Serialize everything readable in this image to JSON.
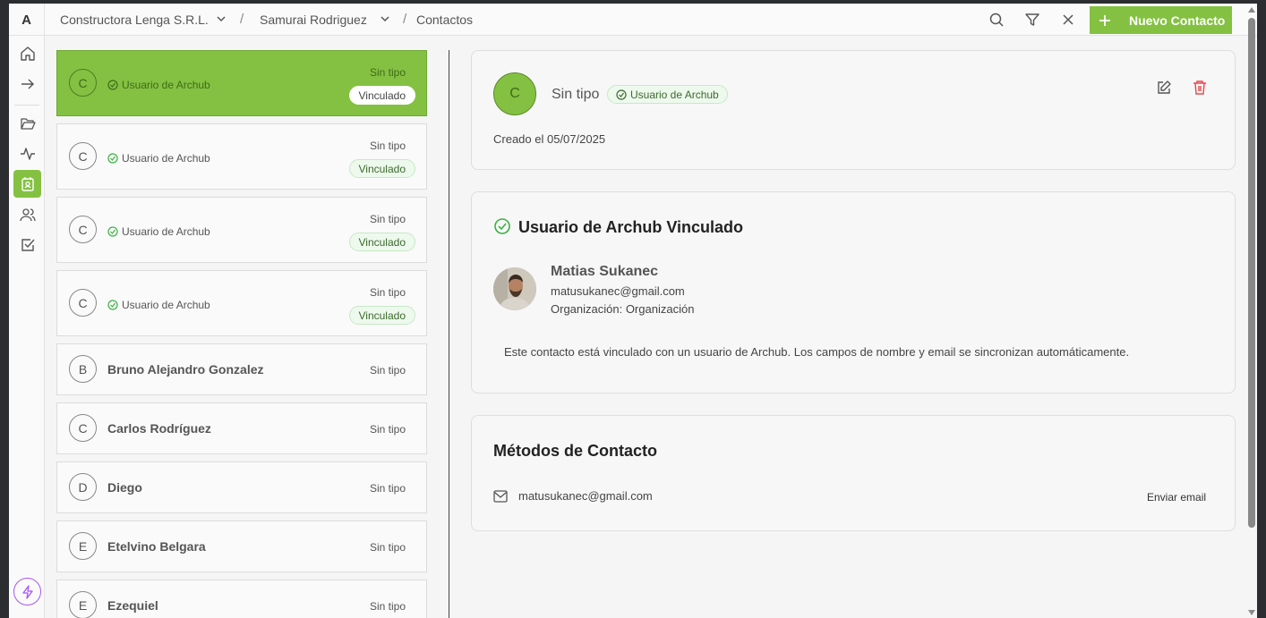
{
  "app": {
    "logo": "A"
  },
  "breadcrumb": {
    "org": "Constructora Lenga S.R.L.",
    "project": "Samurai Rodriguez",
    "page": "Contactos",
    "sep": "/"
  },
  "toolbar": {
    "new_label": "Nuevo Contacto"
  },
  "contacts": [
    {
      "initial": "C",
      "linked_label": "Usuario de Archub",
      "type": "Sin tipo",
      "badge": "Vinculado"
    },
    {
      "initial": "C",
      "linked_label": "Usuario de Archub",
      "type": "Sin tipo",
      "badge": "Vinculado"
    },
    {
      "initial": "C",
      "linked_label": "Usuario de Archub",
      "type": "Sin tipo",
      "badge": "Vinculado"
    },
    {
      "initial": "C",
      "linked_label": "Usuario de Archub",
      "type": "Sin tipo",
      "badge": "Vinculado"
    },
    {
      "initial": "B",
      "name": "Bruno Alejandro Gonzalez",
      "type": "Sin tipo"
    },
    {
      "initial": "C",
      "name": "Carlos Rodríguez",
      "type": "Sin tipo"
    },
    {
      "initial": "D",
      "name": "Diego",
      "type": "Sin tipo"
    },
    {
      "initial": "E",
      "name": "Etelvino Belgara",
      "type": "Sin tipo"
    },
    {
      "initial": "E",
      "name": "Ezequiel",
      "type": "Sin tipo"
    }
  ],
  "detail": {
    "initial": "C",
    "type": "Sin tipo",
    "tag": "Usuario de Archub",
    "created": "Creado el 05/07/2025"
  },
  "linked_user": {
    "title": "Usuario de Archub Vinculado",
    "name": "Matias Sukanec",
    "email": "matusukanec@gmail.com",
    "org": "Organización: Organización",
    "note": "Este contacto está vinculado con un usuario de Archub. Los campos de nombre y email se sincronizan automáticamente."
  },
  "methods": {
    "title": "Métodos de Contacto",
    "email": "matusukanec@gmail.com",
    "action": "Enviar email"
  },
  "colors": {
    "accent": "#84c142",
    "danger": "#e5484d",
    "bolt": "#a855f7"
  }
}
